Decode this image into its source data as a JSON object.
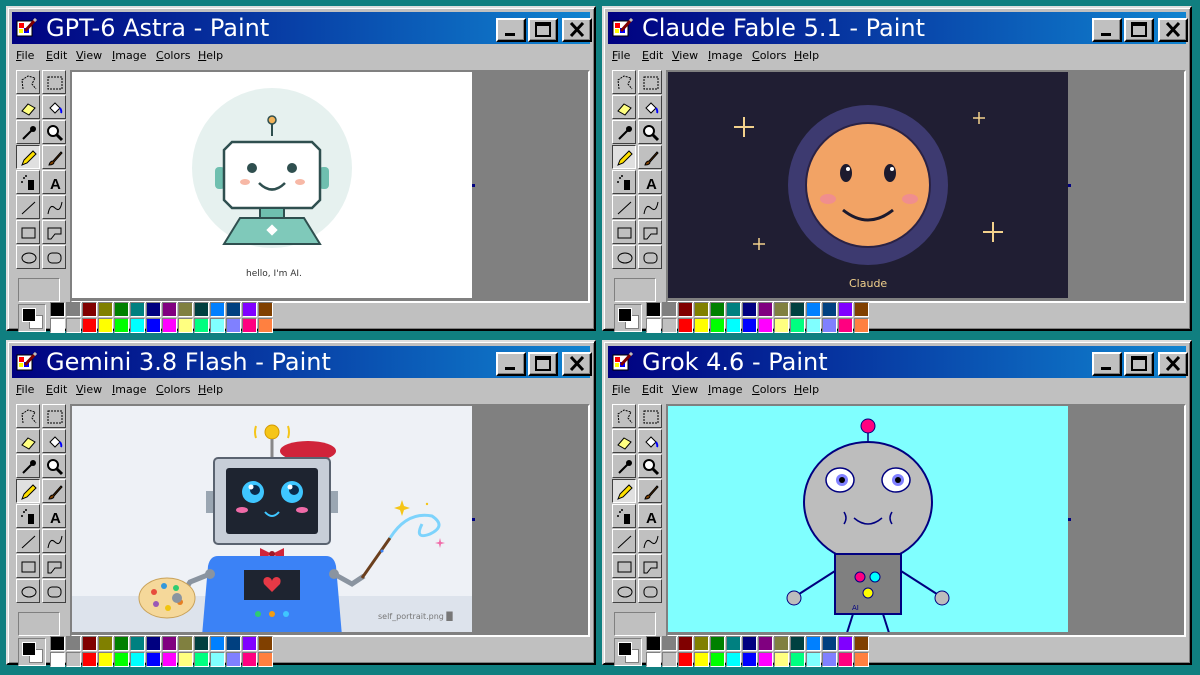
{
  "windows": [
    {
      "id": "gpt",
      "title": "GPT-6 Astra - Paint",
      "caption": "hello, I'm AI."
    },
    {
      "id": "claude",
      "title": "Claude Fable 5.1 - Paint",
      "caption": "Claude"
    },
    {
      "id": "gemini",
      "title": "Gemini 3.8 Flash - Paint",
      "caption": "self_portrait.png █"
    },
    {
      "id": "grok",
      "title": "Grok 4.6 - Paint",
      "caption": "AI"
    }
  ],
  "menu": [
    "File",
    "Edit",
    "View",
    "Image",
    "Colors",
    "Help"
  ],
  "tools": [
    "free-select",
    "rect-select",
    "eraser",
    "fill",
    "color-picker",
    "magnifier",
    "pencil",
    "brush",
    "airbrush",
    "text",
    "line",
    "curve",
    "rectangle",
    "polygon",
    "ellipse",
    "rounded-rectangle"
  ],
  "selected_tool": "pencil",
  "palette_top": [
    "#000000",
    "#808080",
    "#800000",
    "#808000",
    "#008000",
    "#008080",
    "#000080",
    "#800080",
    "#808040",
    "#004040",
    "#0080ff",
    "#004080",
    "#8000ff",
    "#804000"
  ],
  "palette_bottom": [
    "#ffffff",
    "#c0c0c0",
    "#ff0000",
    "#ffff00",
    "#00ff00",
    "#00ffff",
    "#0000ff",
    "#ff00ff",
    "#ffff80",
    "#00ff80",
    "#80ffff",
    "#8080ff",
    "#ff0080",
    "#ff8040"
  ],
  "canvas_backgrounds": {
    "gpt": "#ffffff",
    "claude": "#201e33",
    "gemini": "#eef1f6",
    "grok": "#80ffff"
  }
}
